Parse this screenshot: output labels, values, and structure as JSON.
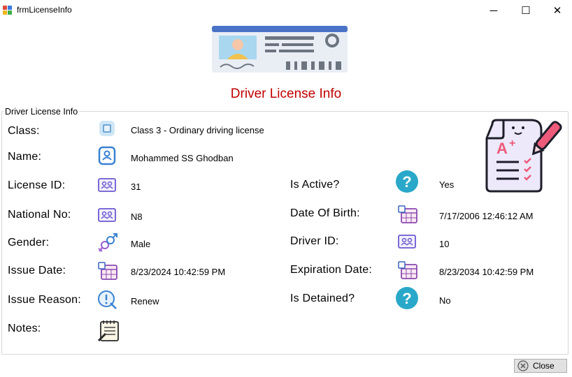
{
  "window": {
    "title": "frmLicenseInfo",
    "minimize_glyph": "─",
    "maximize_glyph": "☐",
    "close_glyph": "✕"
  },
  "header": {
    "title": "Driver License Info",
    "title_color": "#c00000"
  },
  "group": {
    "legend": "Driver License Info"
  },
  "fields": {
    "class": {
      "label": "Class:",
      "value": "Class 3 - Ordinary driving license",
      "icon": "license-class-icon"
    },
    "name": {
      "label": "Name:",
      "value": "Mohammed SS  Ghodban",
      "icon": "person-card-icon"
    },
    "license_id": {
      "label": "License ID:",
      "value": "31",
      "icon": "id-card-icon"
    },
    "national_no": {
      "label": "National No:",
      "value": "N8",
      "icon": "id-card-icon"
    },
    "gender": {
      "label": "Gender:",
      "value": "Male",
      "icon": "gender-icon"
    },
    "issue_date": {
      "label": "Issue Date:",
      "value": "8/23/2024 10:42:59 PM",
      "icon": "calendar-icon"
    },
    "issue_reason": {
      "label": "Issue Reason:",
      "value": "Renew",
      "icon": "info-reason-icon"
    },
    "notes": {
      "label": "Notes:",
      "value": "",
      "icon": "notepad-icon"
    },
    "is_active": {
      "label": "Is Active?",
      "value": "Yes",
      "icon": "question-icon"
    },
    "date_of_birth": {
      "label": "Date Of Birth:",
      "value": "7/17/2006 12:46:12 AM",
      "icon": "calendar-icon"
    },
    "driver_id": {
      "label": "Driver ID:",
      "value": "10",
      "icon": "id-card-icon"
    },
    "expiration_date": {
      "label": "Expiration Date:",
      "value": "8/23/2034 10:42:59 PM",
      "icon": "calendar-icon"
    },
    "is_detained": {
      "label": "Is Detained?",
      "value": "No",
      "icon": "question-icon"
    }
  },
  "buttons": {
    "close_label": "Close"
  },
  "colors": {
    "question_icon": "#29a8c9",
    "accent_blue": "#4a73c7"
  }
}
